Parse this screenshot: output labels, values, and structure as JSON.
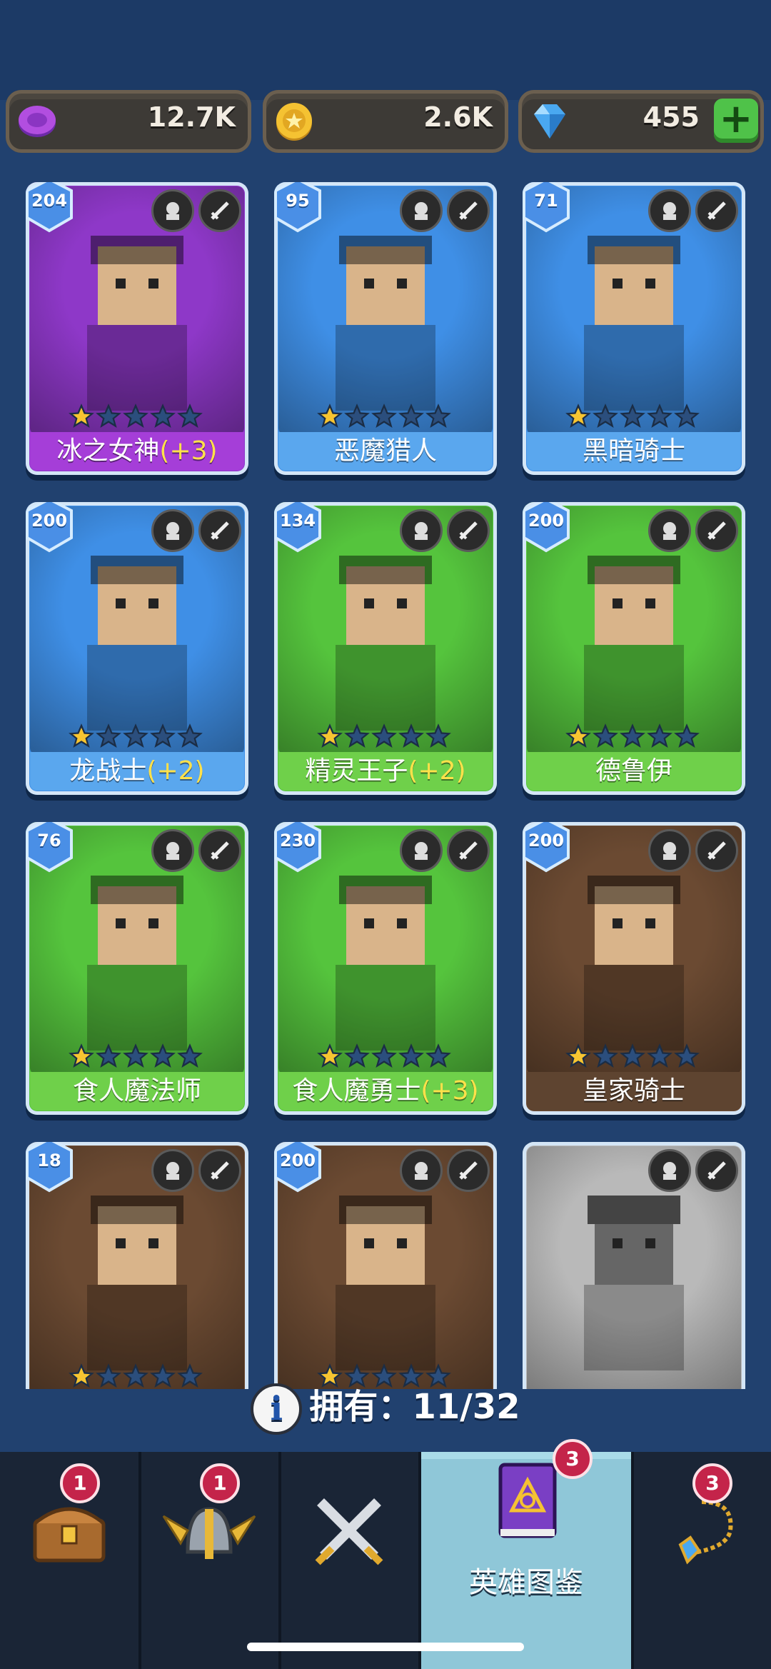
{
  "resources": {
    "potion": {
      "value": "12.7K",
      "icon": "purple-coin-icon"
    },
    "gold": {
      "value": "2.6K",
      "icon": "gold-coin-icon"
    },
    "gems": {
      "value": "455",
      "icon": "gem-icon",
      "add_label": "+"
    }
  },
  "heroes": [
    {
      "level": "204",
      "name": "冰之女神",
      "bonus": "(+3)",
      "stars": 1,
      "theme": "purple"
    },
    {
      "level": "95",
      "name": "恶魔猎人",
      "bonus": "",
      "stars": 1,
      "theme": "blue"
    },
    {
      "level": "71",
      "name": "黑暗骑士",
      "bonus": "",
      "stars": 1,
      "theme": "blue"
    },
    {
      "level": "200",
      "name": "龙战士",
      "bonus": "(+2)",
      "stars": 1,
      "theme": "blue"
    },
    {
      "level": "134",
      "name": "精灵王子",
      "bonus": "(+2)",
      "stars": 1,
      "theme": "green"
    },
    {
      "level": "200",
      "name": "德鲁伊",
      "bonus": "",
      "stars": 1,
      "theme": "green"
    },
    {
      "level": "76",
      "name": "食人魔法师",
      "bonus": "",
      "stars": 1,
      "theme": "green"
    },
    {
      "level": "230",
      "name": "食人魔勇士",
      "bonus": "(+3)",
      "stars": 1,
      "theme": "green"
    },
    {
      "level": "200",
      "name": "皇家骑士",
      "bonus": "",
      "stars": 1,
      "theme": "brown"
    },
    {
      "level": "18",
      "name": "",
      "bonus": "",
      "stars": 1,
      "theme": "brown"
    },
    {
      "level": "200",
      "name": "",
      "bonus": "",
      "stars": 1,
      "theme": "brown"
    },
    {
      "level": "",
      "name": "",
      "bonus": "",
      "stars": 0,
      "theme": "gray"
    }
  ],
  "owned": {
    "label": "拥有：",
    "count": "11/32"
  },
  "nav": {
    "tabs": [
      {
        "icon": "treasure-chest-icon",
        "badge": "1",
        "label": ""
      },
      {
        "icon": "winged-helmet-icon",
        "badge": "1",
        "label": ""
      },
      {
        "icon": "crossed-swords-icon",
        "badge": "",
        "label": ""
      },
      {
        "icon": "spellbook-icon",
        "badge": "3",
        "label": "英雄图鉴",
        "active": true
      },
      {
        "icon": "amulet-icon",
        "badge": "3",
        "label": ""
      }
    ]
  },
  "colors": {
    "purple": "#8e38c8",
    "blue": "#3f8fe6",
    "green": "#55c43d",
    "brown": "#6b4a32",
    "gray": "#b9b9b9"
  }
}
